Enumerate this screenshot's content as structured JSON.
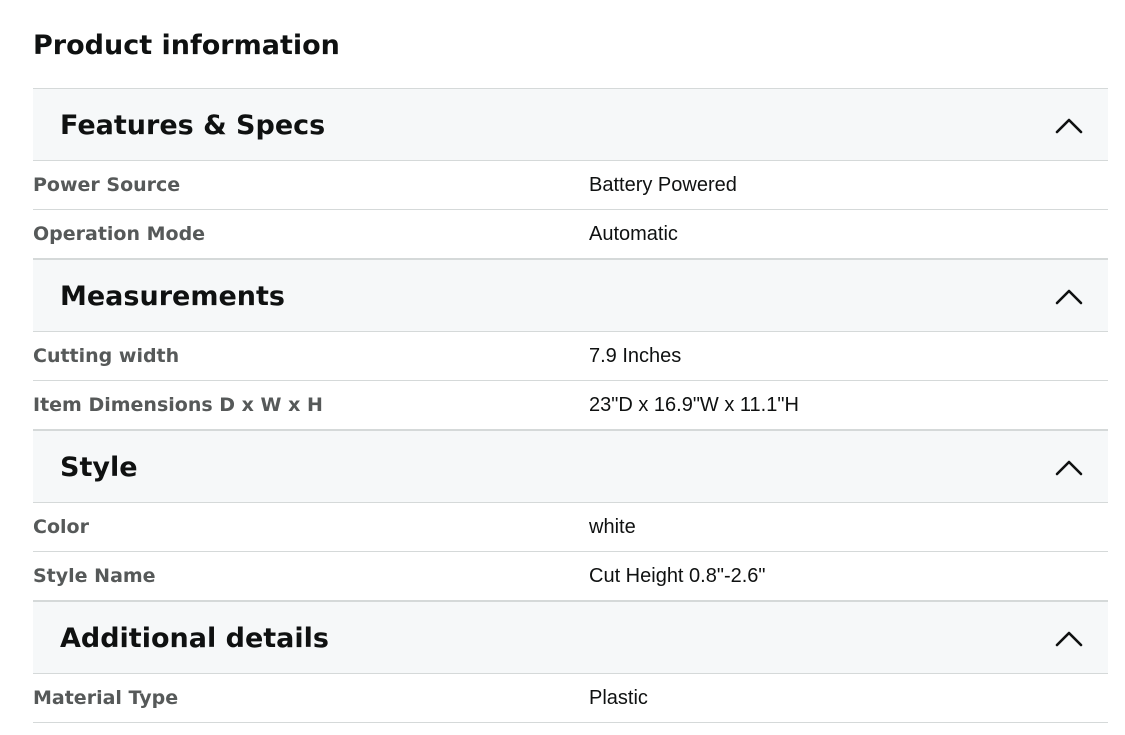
{
  "page": {
    "title": "Product information"
  },
  "sections": [
    {
      "title": "Features & Specs",
      "rows": [
        {
          "label": "Power Source",
          "value": "Battery Powered"
        },
        {
          "label": "Operation Mode",
          "value": "Automatic"
        }
      ]
    },
    {
      "title": "Measurements",
      "rows": [
        {
          "label": "Cutting width",
          "value": "7.9 Inches"
        },
        {
          "label": "Item Dimensions D x W x H",
          "value": "23\"D x 16.9\"W x 11.1\"H"
        }
      ]
    },
    {
      "title": "Style",
      "rows": [
        {
          "label": "Color",
          "value": "white"
        },
        {
          "label": "Style Name",
          "value": "Cut Height 0.8\"-2.6\""
        }
      ]
    },
    {
      "title": "Additional details",
      "rows": [
        {
          "label": "Material Type",
          "value": "Plastic"
        }
      ]
    }
  ],
  "icons": {
    "collapse": "chevron-up-icon"
  },
  "colors": {
    "header_bg": "#f6f8f9",
    "divider": "#d5d9d9",
    "label_text": "#565959",
    "value_text": "#0f1111"
  }
}
